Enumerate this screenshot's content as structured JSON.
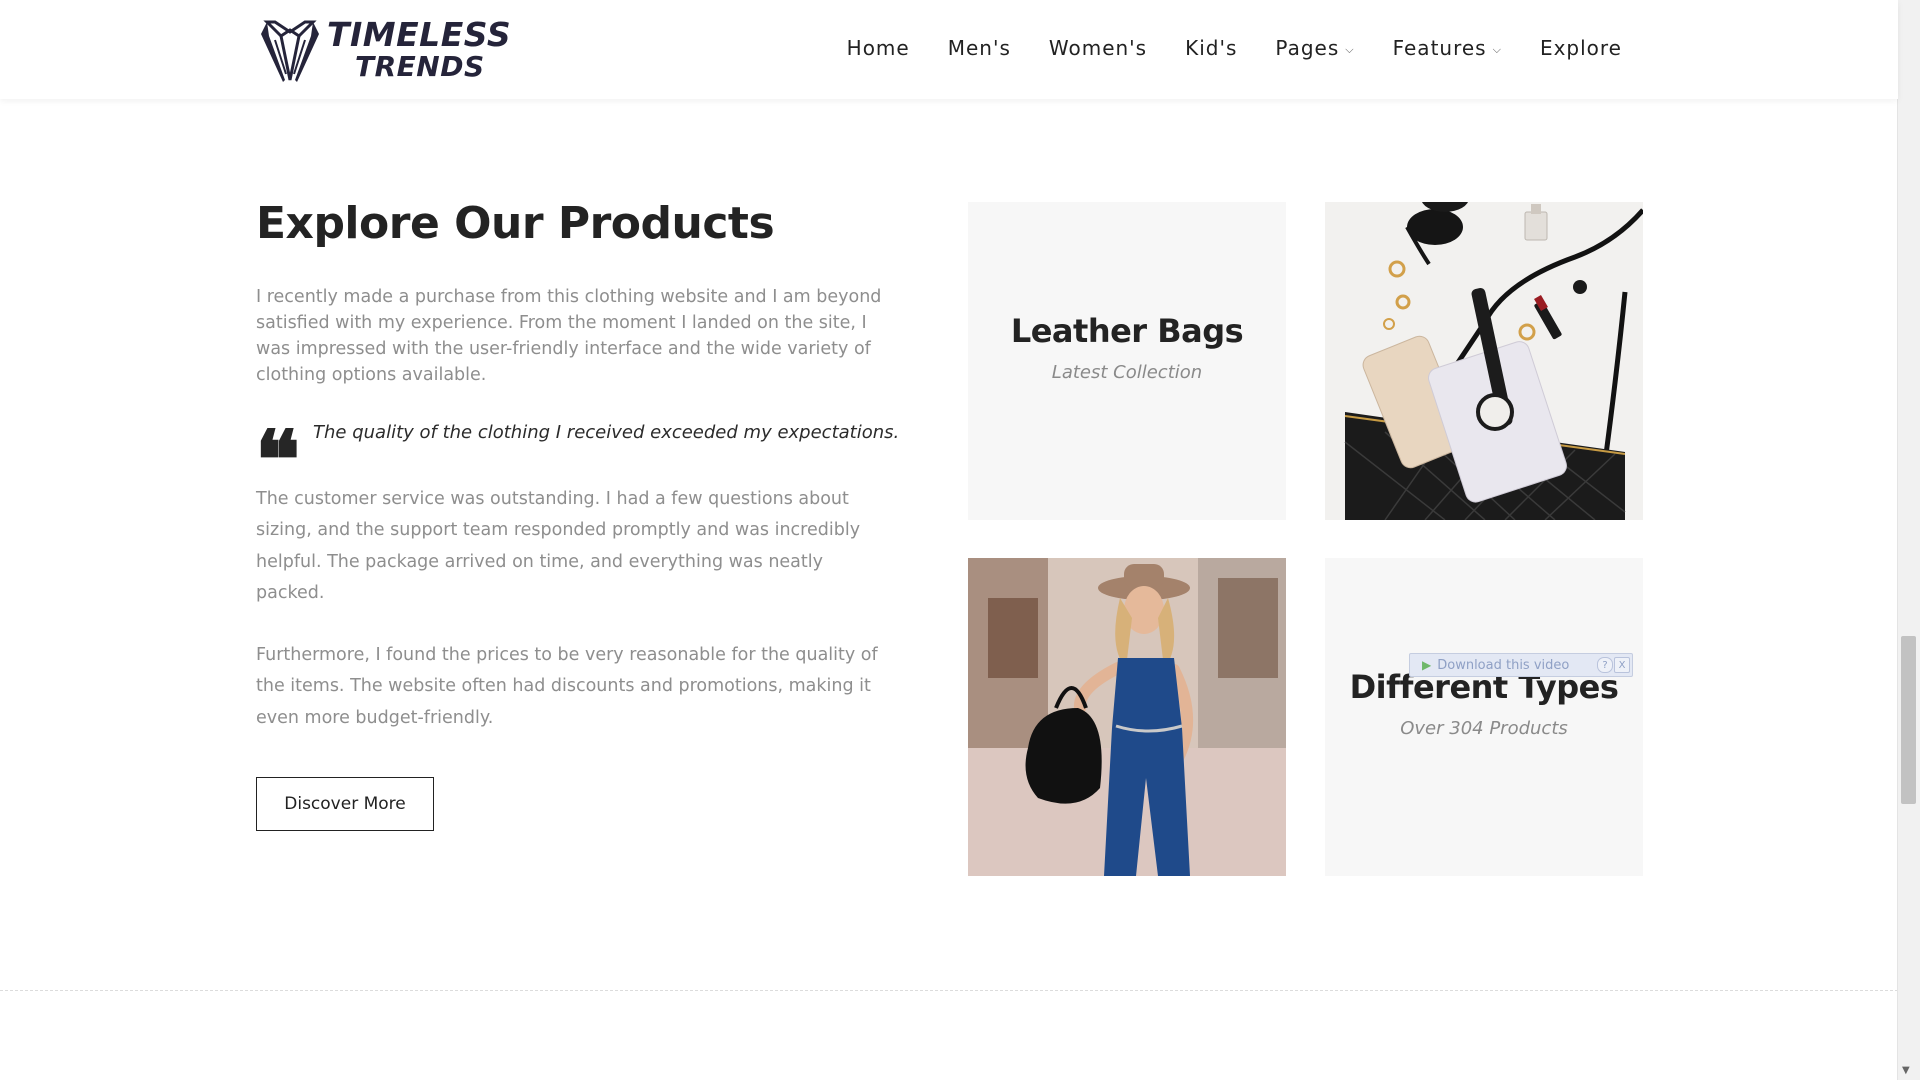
{
  "brand": {
    "line1": "TIMELESS",
    "line2": "TRENDS"
  },
  "nav": {
    "items": [
      {
        "label": "Home",
        "dropdown": false
      },
      {
        "label": "Men's",
        "dropdown": false
      },
      {
        "label": "Women's",
        "dropdown": false
      },
      {
        "label": "Kid's",
        "dropdown": false
      },
      {
        "label": "Pages",
        "dropdown": true
      },
      {
        "label": "Features",
        "dropdown": true
      },
      {
        "label": "Explore",
        "dropdown": false
      }
    ],
    "chevron": "⌵"
  },
  "section": {
    "title": "Explore Our Products",
    "intro": "I recently made a purchase from this clothing website and I am beyond satisfied with my experience. From the moment I landed on the site, I was impressed with the user-friendly interface and the wide variety of clothing options available.",
    "quote_mark": "❝",
    "quote": "The quality of the clothing I received exceeded my expectations.",
    "para1": "The customer service was outstanding. I had a few questions about sizing, and the support team responded promptly and was incredibly helpful. The package arrived on time, and everything was neatly packed.",
    "para2": "Furthermore, I found the prices to be very reasonable for the quality of the items. The website often had discounts and promotions, making it even more budget-friendly.",
    "button_label": "Discover More"
  },
  "tiles": [
    {
      "title": "Leather Bags",
      "subtitle": "Latest Collection"
    },
    {
      "image": "bag-accessories-photo"
    },
    {
      "image": "woman-blue-jumpsuit-photo"
    },
    {
      "title": "Different Types",
      "subtitle": "Over 304 Products"
    }
  ],
  "download_overlay": {
    "play": "▶",
    "label": "Download this video",
    "help": "?",
    "close": "X"
  },
  "scrollbar": {
    "down_arrow": "▼"
  },
  "colors": {
    "heading": "#232323",
    "body_text": "#8e8e8e",
    "tile_bg": "#f7f7f7",
    "brand": "#25243a"
  }
}
